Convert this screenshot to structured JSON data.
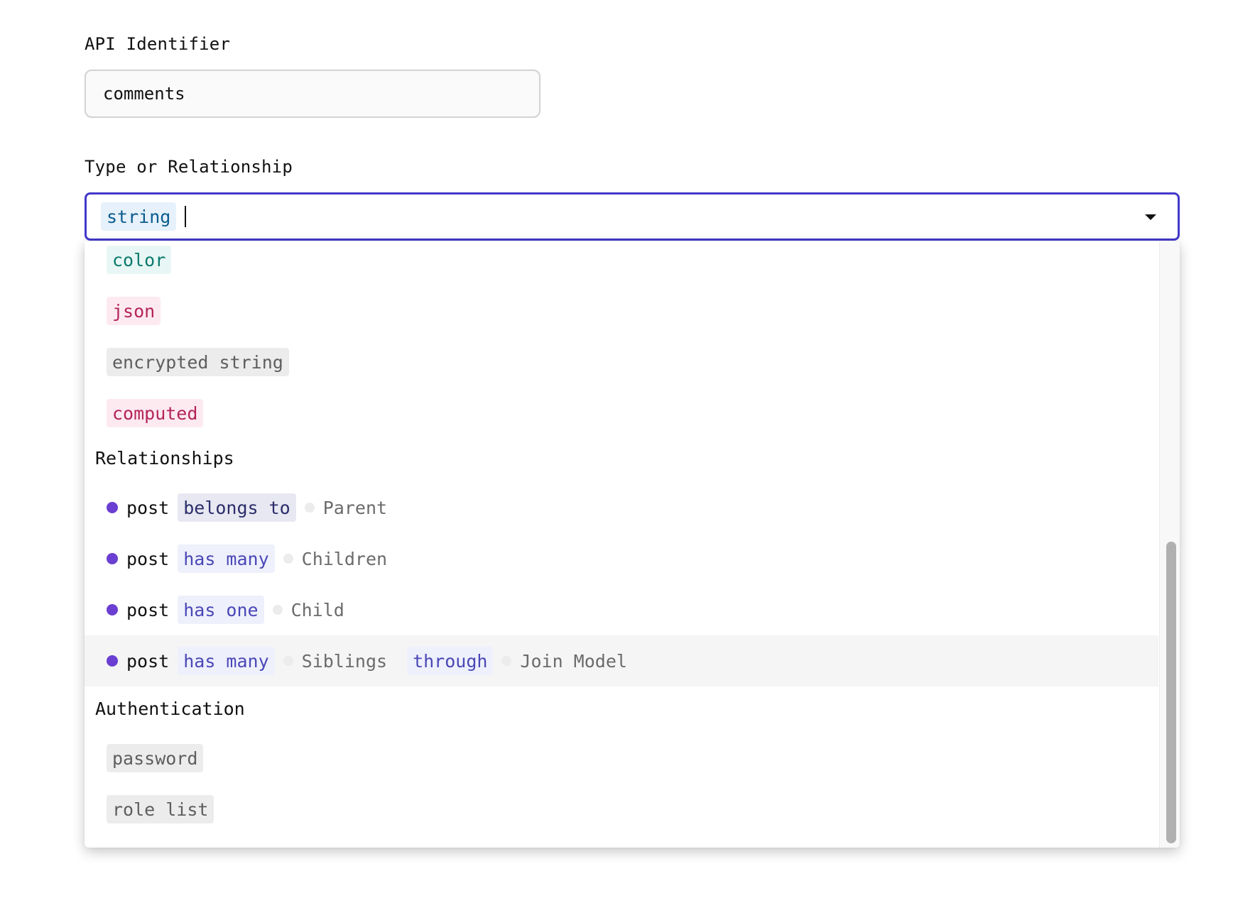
{
  "api_identifier": {
    "label": "API Identifier",
    "value": "comments"
  },
  "type_field": {
    "label": "Type or Relationship",
    "selected": "string"
  },
  "menu": {
    "type_options": [
      {
        "label": "color",
        "color": "#0e7a6d"
      },
      {
        "label": "json",
        "color": "#b4245a"
      },
      {
        "label": "encrypted string",
        "color": "#5e5e5e"
      },
      {
        "label": "computed",
        "color": "#b4245a"
      }
    ],
    "relationships_heading": "Relationships",
    "relationships": [
      {
        "model": "post",
        "relation": "belongs to",
        "role": "Parent"
      },
      {
        "model": "post",
        "relation": "has many",
        "role": "Children"
      },
      {
        "model": "post",
        "relation": "has one",
        "role": "Child"
      },
      {
        "model": "post",
        "relation": "has many",
        "role": "Siblings",
        "through": "through",
        "join": "Join Model"
      }
    ],
    "authentication_heading": "Authentication",
    "auth_options": [
      {
        "label": "password"
      },
      {
        "label": "role list"
      }
    ]
  },
  "colors": {
    "focus_border": "#4338ca",
    "model_dot": "#6a3fd1"
  },
  "icons": {
    "dropdown": "chevron-down-icon"
  }
}
